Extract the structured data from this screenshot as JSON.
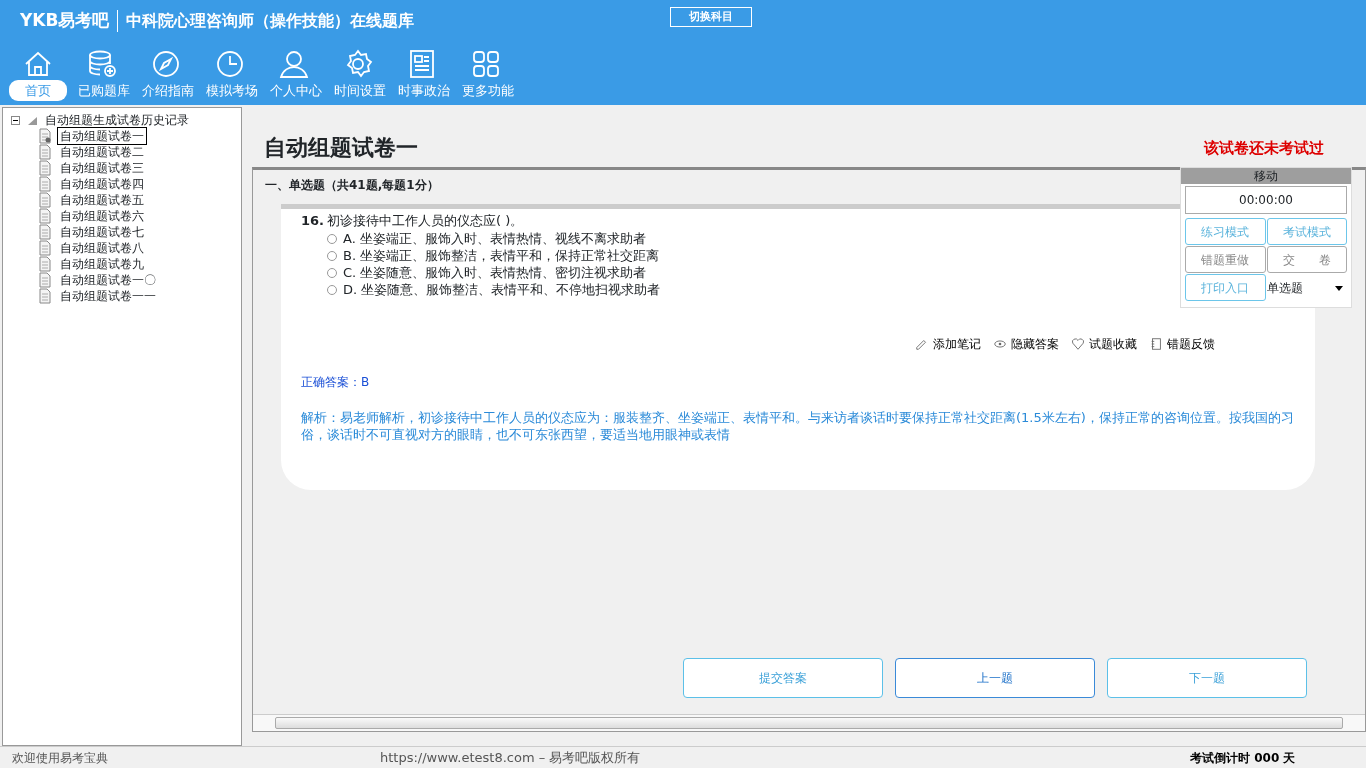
{
  "header": {
    "logo": "YKB易考吧",
    "title": "中科院心理咨询师（操作技能）在线题库",
    "switch_button": "切换科目"
  },
  "nav": [
    {
      "label": "首页",
      "selected": true
    },
    {
      "label": "已购题库",
      "selected": false
    },
    {
      "label": "介绍指南",
      "selected": false
    },
    {
      "label": "模拟考场",
      "selected": false
    },
    {
      "label": "个人中心",
      "selected": false
    },
    {
      "label": "时间设置",
      "selected": false
    },
    {
      "label": "时事政治",
      "selected": false
    },
    {
      "label": "更多功能",
      "selected": false
    }
  ],
  "tree": {
    "label": "自动组题生成试卷历史记录",
    "expanded": true,
    "children": [
      {
        "label": "自动组题试卷一",
        "selected": true
      },
      {
        "label": "自动组题试卷二",
        "selected": false
      },
      {
        "label": "自动组题试卷三",
        "selected": false
      },
      {
        "label": "自动组题试卷四",
        "selected": false
      },
      {
        "label": "自动组题试卷五",
        "selected": false
      },
      {
        "label": "自动组题试卷六",
        "selected": false
      },
      {
        "label": "自动组题试卷七",
        "selected": false
      },
      {
        "label": "自动组题试卷八",
        "selected": false
      },
      {
        "label": "自动组题试卷九",
        "selected": false
      },
      {
        "label": "自动组题试卷一〇",
        "selected": false
      },
      {
        "label": "自动组题试卷一一",
        "selected": false
      }
    ]
  },
  "paper": {
    "title": "自动组题试卷一",
    "status": "该试卷还未考试过",
    "section": "一、单选题（共41题,每题1分）"
  },
  "question": {
    "number": "16.",
    "text": "初诊接待中工作人员的仪态应( )。",
    "options": [
      {
        "text": "A. 坐姿端正、服饰入时、表情热情、视线不离求助者",
        "selected": false
      },
      {
        "text": "B. 坐姿端正、服饰整洁，表情平和，保持正常社交距离",
        "selected": false
      },
      {
        "text": "C. 坐姿随意、服饰入时、表情热情、密切注视求助者",
        "selected": false
      },
      {
        "text": "D. 坐姿随意、服饰整洁、表情平和、不停地扫视求助者",
        "selected": false
      }
    ]
  },
  "tools": [
    "添加笔记",
    "隐藏答案",
    "试题收藏",
    "错题反馈"
  ],
  "answer": {
    "label": "正确答案：",
    "value": "B"
  },
  "analysis": "解析：易老师解析，初诊接待中工作人员的仪态应为：服装整齐、坐姿端正、表情平和。与来访者谈话时要保持正常社交距离(1.5米左右)，保持正常的咨询位置。按我国的习俗，谈话时不可直视对方的眼睛，也不可东张西望，要适当地用眼神或表情",
  "panel": {
    "title": "移动",
    "timer": "00:00:00",
    "buttons": [
      {
        "label": "练习模式",
        "kind": "blue"
      },
      {
        "label": "考试模式",
        "kind": "blue"
      },
      {
        "label": "错题重做",
        "kind": "gray"
      },
      {
        "label": "交　　卷",
        "kind": "gray"
      },
      {
        "label": "打印入口",
        "kind": "blue"
      }
    ],
    "select": "单选题"
  },
  "actions": [
    "提交答案",
    "上一题",
    "下一题"
  ],
  "status_bar": {
    "left": "欢迎使用易考宝典",
    "center": "https://www.etest8.com – 易考吧版权所有",
    "right": "考试倒计时 000 天"
  }
}
